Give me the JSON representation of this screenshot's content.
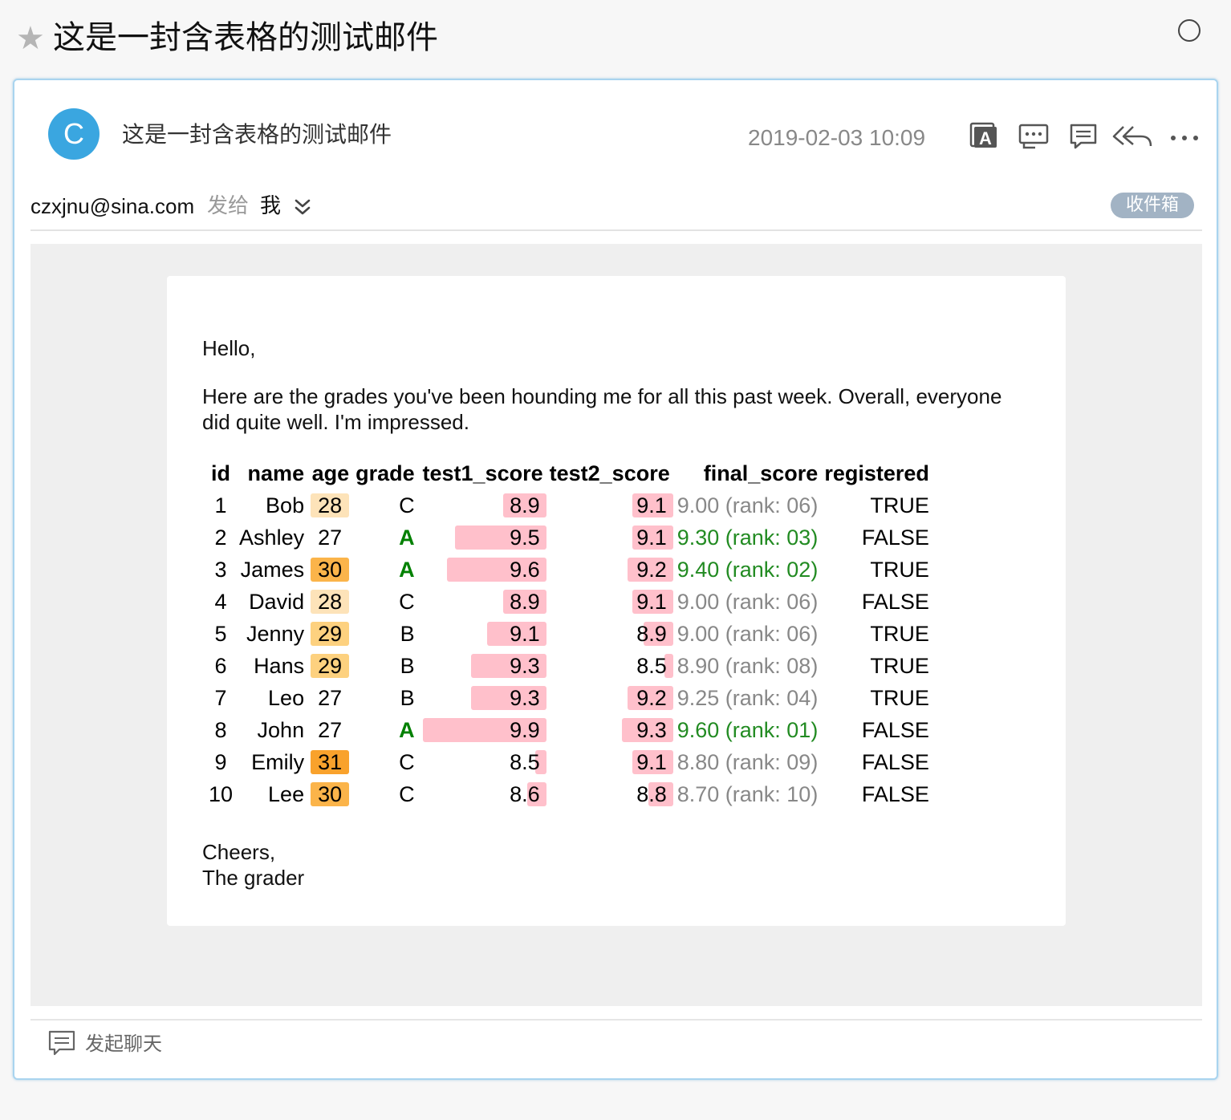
{
  "topbar": {
    "title": "这是一封含表格的测试邮件",
    "star_icon": "star-icon"
  },
  "header": {
    "avatar_letter": "C",
    "subject": "这是一封含表格的测试邮件",
    "date": "2019-02-03 10:09",
    "tools": [
      "translate-icon",
      "message-icon",
      "comment-icon",
      "reply-all-icon",
      "more-icon"
    ]
  },
  "from_row": {
    "email": "czxjnu@sina.com",
    "send_to": "发给",
    "recipient": "我",
    "folder": "收件箱"
  },
  "letter": {
    "greeting": "Hello,",
    "paragraph": "Here are the grades you've been hounding me for all this past week. Overall, everyone did quite well. I'm impressed.",
    "sign_off_1": "Cheers,",
    "sign_off_2": "The grader"
  },
  "table": {
    "headers": [
      "id",
      "name",
      "age",
      "grade",
      "test1_score",
      "test2_score",
      "final_score",
      "registered"
    ],
    "rows": [
      {
        "id": "1",
        "name": "Bob",
        "age": "28",
        "grade": "C",
        "test1": "8.9",
        "test2": "9.1",
        "final": "9.00 (rank: 06)",
        "registered": "TRUE"
      },
      {
        "id": "2",
        "name": "Ashley",
        "age": "27",
        "grade": "A",
        "test1": "9.5",
        "test2": "9.1",
        "final": "9.30 (rank: 03)",
        "registered": "FALSE"
      },
      {
        "id": "3",
        "name": "James",
        "age": "30",
        "grade": "A",
        "test1": "9.6",
        "test2": "9.2",
        "final": "9.40 (rank: 02)",
        "registered": "TRUE"
      },
      {
        "id": "4",
        "name": "David",
        "age": "28",
        "grade": "C",
        "test1": "8.9",
        "test2": "9.1",
        "final": "9.00 (rank: 06)",
        "registered": "FALSE"
      },
      {
        "id": "5",
        "name": "Jenny",
        "age": "29",
        "grade": "B",
        "test1": "9.1",
        "test2": "8.9",
        "final": "9.00 (rank: 06)",
        "registered": "TRUE"
      },
      {
        "id": "6",
        "name": "Hans",
        "age": "29",
        "grade": "B",
        "test1": "9.3",
        "test2": "8.5",
        "final": "8.90 (rank: 08)",
        "registered": "TRUE"
      },
      {
        "id": "7",
        "name": "Leo",
        "age": "27",
        "grade": "B",
        "test1": "9.3",
        "test2": "9.2",
        "final": "9.25 (rank: 04)",
        "registered": "TRUE"
      },
      {
        "id": "8",
        "name": "John",
        "age": "27",
        "grade": "A",
        "test1": "9.9",
        "test2": "9.3",
        "final": "9.60 (rank: 01)",
        "registered": "FALSE"
      },
      {
        "id": "9",
        "name": "Emily",
        "age": "31",
        "grade": "C",
        "test1": "8.5",
        "test2": "9.1",
        "final": "8.80 (rank: 09)",
        "registered": "FALSE"
      },
      {
        "id": "10",
        "name": "Lee",
        "age": "30",
        "grade": "C",
        "test1": "8.6",
        "test2": "8.8",
        "final": "8.70 (rank: 10)",
        "registered": "FALSE"
      }
    ],
    "colors": {
      "bar": "#ffc0cb",
      "age_27": "transparent",
      "age_28": "#fde3b9",
      "age_29": "#fdd17f",
      "age_30": "#fbb44a",
      "age_31": "#f9a22c",
      "grade_a": "#008000",
      "final_top": "#228b22",
      "final_rest": "#888888"
    },
    "top_final_ranks": [
      "01",
      "02",
      "03"
    ]
  },
  "footer": {
    "chat_label": "发起聊天",
    "chat_icon": "chat-icon"
  }
}
